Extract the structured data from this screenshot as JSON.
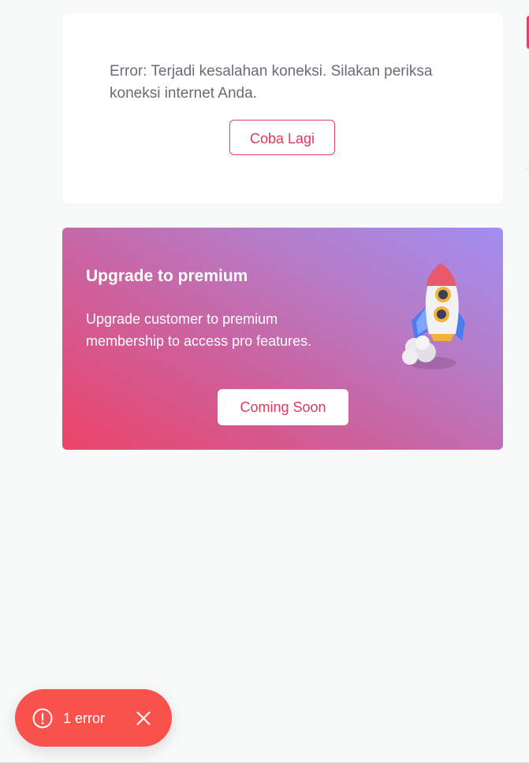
{
  "error_card": {
    "message": "Error: Terjadi kesalahan koneksi. Silakan periksa koneksi internet Anda.",
    "retry_label": "Coba Lagi"
  },
  "premium_card": {
    "title": "Upgrade to premium",
    "description": "Upgrade customer to premium membership to access pro features.",
    "button_label": "Coming Soon",
    "illustration": "rocket-icon"
  },
  "toast": {
    "icon": "alert-circle-icon",
    "label": "1 error",
    "close_icon": "close-icon"
  },
  "colors": {
    "accent": "#e3385c",
    "toast_bg": "#f9524c",
    "gradient_start": "#ec4468",
    "gradient_end": "#a28ef2",
    "page_bg": "#f8f9f9"
  }
}
